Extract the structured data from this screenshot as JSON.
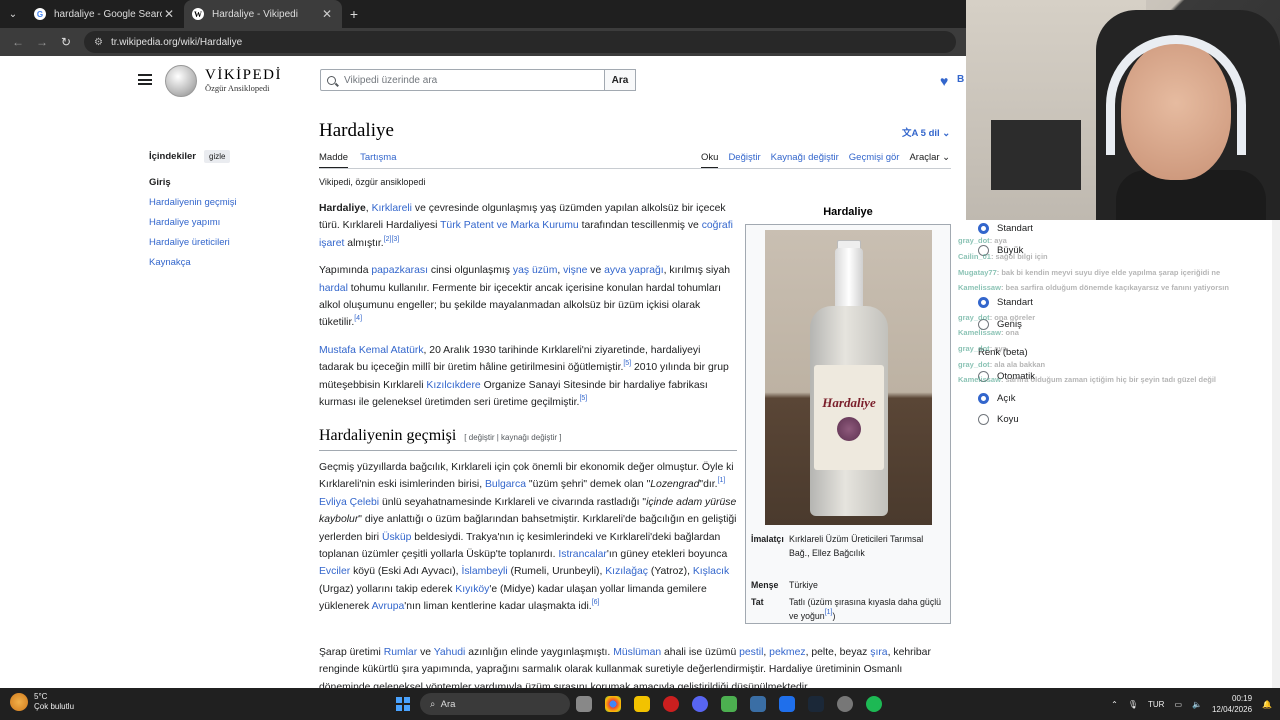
{
  "browser": {
    "tabs": [
      {
        "title": "hardaliye - Google Search",
        "favicon": "G"
      },
      {
        "title": "Hardaliye - Vikipedi",
        "favicon": "W"
      }
    ],
    "url": "tr.wikipedia.org/wiki/Hardaliye"
  },
  "header": {
    "logo_name": "VİKİPEDİ",
    "logo_sub": "Özgür Ansiklopedi",
    "search_placeholder": "Vikipedi üzerinde ara",
    "search_button": "Ara",
    "donate_label": "B"
  },
  "toc": {
    "title": "İçindekiler",
    "hide": "gizle",
    "items": [
      "Giriş",
      "Hardaliyenin geçmişi",
      "Hardaliye yapımı",
      "Hardaliye üreticileri",
      "Kaynakça"
    ]
  },
  "article": {
    "title": "Hardaliye",
    "languages": "5 dil",
    "tabs_left": [
      "Madde",
      "Tartışma"
    ],
    "tabs_right": [
      "Oku",
      "Değiştir",
      "Kaynağı değiştir",
      "Geçmişi gör",
      "Araçlar"
    ],
    "from": "Vikipedi, özgür ansiklopedi",
    "section_heading": "Hardaliyenin geçmişi",
    "section_edit": "[ değiştir | kaynağı değiştir ]"
  },
  "infobox": {
    "title": "Hardaliye",
    "bottle_brand": "Hardaliye",
    "rows": [
      {
        "key": "İmalatçı",
        "value": "Kırklareli Üzüm Üreticileri Tarımsal Bağ., Ellez Bağcılık"
      },
      {
        "key": "Menşe",
        "value": "Türkiye"
      },
      {
        "key": "Tat",
        "value": "Tatlı (üzüm şırasına kıyasla daha güçlü ve yoğun"
      }
    ]
  },
  "panel": {
    "text_size": [
      "Standart",
      "Büyük"
    ],
    "width": [
      "Standart",
      "Geniş"
    ],
    "color_header": "Renk (beta)",
    "color": [
      "Otomatik",
      "Açık",
      "Koyu"
    ],
    "chat": [
      {
        "user": "gray_dot",
        "text": ": aya"
      },
      {
        "user": "Cailin_01",
        "text": ": sağol bilgi için"
      },
      {
        "user": "Mugatay77",
        "text": ": bak bi kendin meyvi suyu diye elde yapılma şarap içeriğidi ne"
      },
      {
        "user": "Kamelissaw",
        "text": ": bea sarfira olduğum dönemde kaçıkayarsız ve fanını yatiyorsın"
      },
      {
        "user": "gray_dot",
        "text": ": ona göreler"
      },
      {
        "user": "Kamelissaw",
        "text": ": ona"
      },
      {
        "user": "gray_dot",
        "text": ": aya"
      },
      {
        "user": "gray_dot",
        "text": ": ala ala bakkan"
      },
      {
        "user": "Kamelissaw",
        "text": ": sarfira olduğum zaman içtiğim hiç bir şeyin tadı güzel değil"
      }
    ]
  },
  "taskbar": {
    "temp": "5°C",
    "weather": "Çok bulutlu",
    "search": "Ara",
    "lang": "TUR",
    "time": "00:19",
    "date": "12/04/2026"
  }
}
